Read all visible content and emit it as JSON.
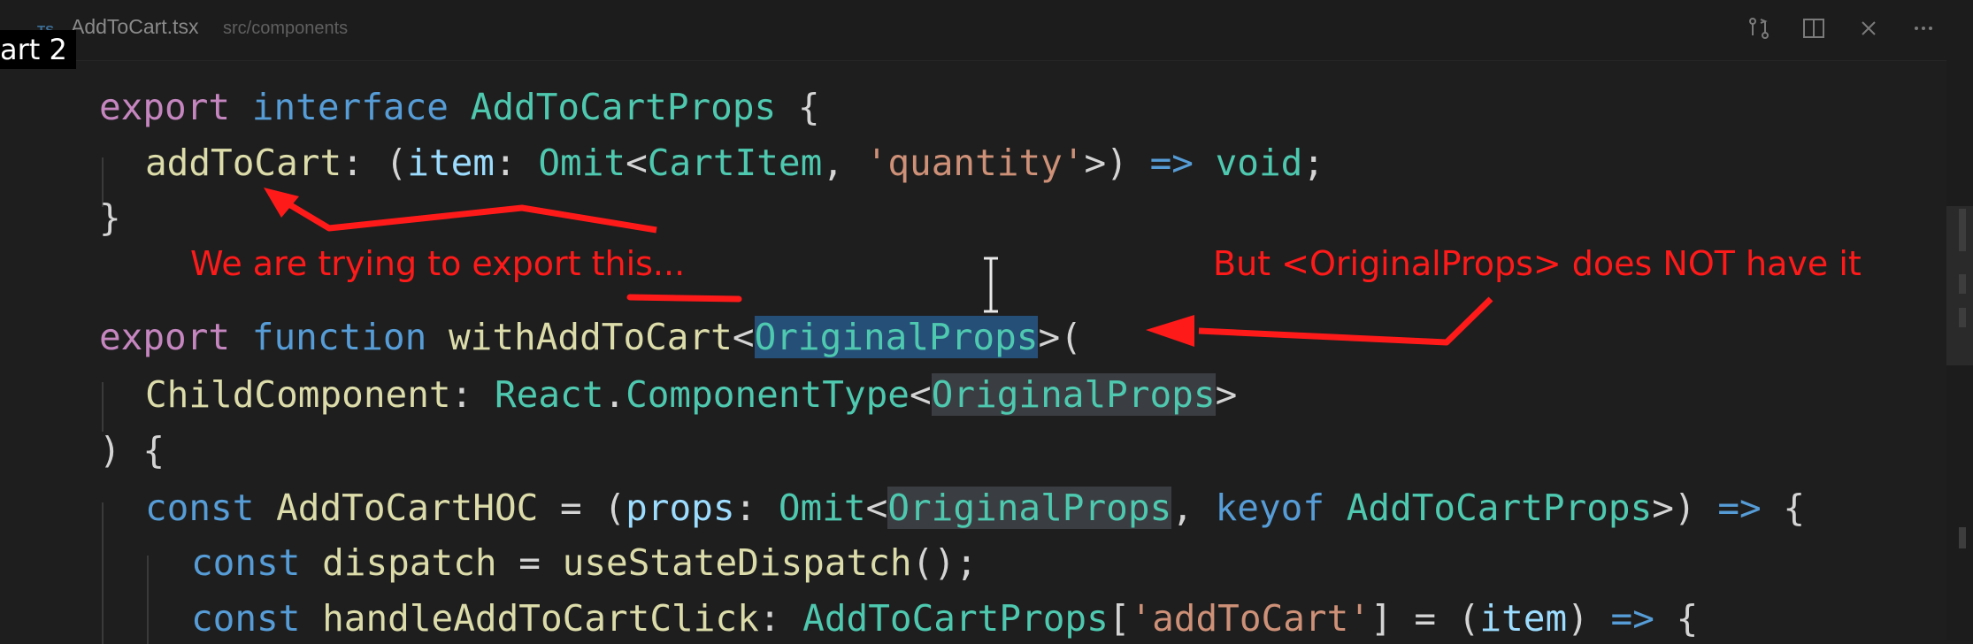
{
  "tab": {
    "lang_badge": "TS",
    "file_name": "AddToCart.tsx",
    "file_path": "src/components"
  },
  "overlay_text": "art 2",
  "code": {
    "l1": {
      "kw": "export",
      "kw2": "interface",
      "name": "AddToCartProps",
      "brace": " {"
    },
    "l2": {
      "prop": "addToCart",
      "p1": ": (",
      "param": "item",
      "p2": ": ",
      "omit": "Omit",
      "lt": "<",
      "ci": "CartItem",
      "comma": ", ",
      "str": "'quantity'",
      "p3": ">) ",
      "arrow": "=>",
      "void": " void",
      "semi": ";"
    },
    "l3": {
      "brace": "}"
    },
    "l4": {
      "kw": "export",
      "kw2": "function",
      "fn": "withAddToCart",
      "lt": "<",
      "sel": "OriginalProps",
      "gt": ">("
    },
    "l5": {
      "child": "ChildComponent",
      "colon": ": ",
      "react": "React",
      "dot": ".",
      "ct": "ComponentType",
      "lt": "<",
      "op": "OriginalProps",
      "gt": ">"
    },
    "l6": {
      "text": ") {"
    },
    "l7": {
      "kw": "const",
      "name": " AddToCartHOC",
      "eq": " = (",
      "props": "props",
      "c": ": ",
      "omit": "Omit",
      "lt": "<",
      "op": "OriginalProps",
      "comma": ", ",
      "keyof": "keyof",
      "atcp": " AddToCartProps",
      "gt": ">) ",
      "arrow": "=>",
      "brace": " {"
    },
    "l8": {
      "kw": "const",
      "name": " dispatch",
      "eq": " = ",
      "fn": "useStateDispatch",
      "end": "();"
    },
    "l9": {
      "kw": "const",
      "name": " handleAddToCartClick",
      "c": ": ",
      "atcp": "AddToCartProps",
      "lb": "[",
      "str": "'addToCart'",
      "rb": "] = (",
      "item": "item",
      "rp": ") ",
      "arrow": "=>",
      "brace": " {"
    }
  },
  "annotations": {
    "left_note": "We are trying to export this...",
    "right_note": "But <OriginalProps> does NOT have it"
  },
  "colors": {
    "annotation": "#ff1a1a",
    "selection": "#264f78"
  }
}
